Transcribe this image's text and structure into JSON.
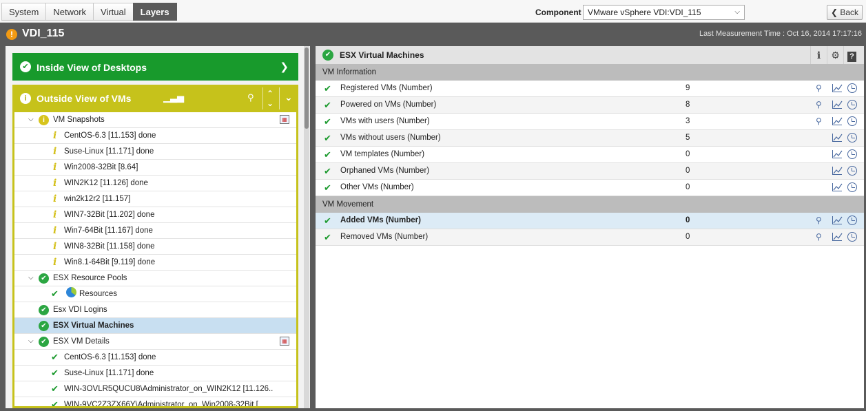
{
  "tabs": [
    "System",
    "Network",
    "Virtual",
    "Layers"
  ],
  "active_tab": "Layers",
  "component": {
    "label": "Component",
    "value": "VMware vSphere VDI:VDI_115"
  },
  "back_label": "Back",
  "title": "VDI_115",
  "last_measurement": "Last Measurement Time : Oct 16, 2014 17:17:16",
  "left": {
    "inside_view": "Inside View of Desktops",
    "outside_view": "Outside View of VMs",
    "tree": [
      {
        "label": "VM Snapshots",
        "level": 1,
        "icon": "yellow-info",
        "expanded": true,
        "tool": true
      },
      {
        "label": "CentOS-6.3 [11.153] done",
        "level": 2,
        "icon": "info-i"
      },
      {
        "label": "Suse-Linux [11.171] done",
        "level": 2,
        "icon": "info-i"
      },
      {
        "label": "Win2008-32Bit [8.64]",
        "level": 2,
        "icon": "info-i"
      },
      {
        "label": "WIN2K12 [11.126] done",
        "level": 2,
        "icon": "info-i"
      },
      {
        "label": "win2k12r2 [11.157]",
        "level": 2,
        "icon": "info-i"
      },
      {
        "label": "WIN7-32Bit [11.202] done",
        "level": 2,
        "icon": "info-i"
      },
      {
        "label": "Win7-64Bit [11.167] done",
        "level": 2,
        "icon": "info-i"
      },
      {
        "label": "WIN8-32Bit [11.158] done",
        "level": 2,
        "icon": "info-i"
      },
      {
        "label": "Win8.1-64Bit [9.119] done",
        "level": 2,
        "icon": "info-i"
      },
      {
        "label": "ESX Resource Pools",
        "level": 1,
        "icon": "green",
        "expanded": true
      },
      {
        "label": "Resources",
        "level": 2,
        "icon": "check-pie"
      },
      {
        "label": "Esx VDI Logins",
        "level": 1,
        "icon": "green"
      },
      {
        "label": "ESX Virtual Machines",
        "level": 1,
        "icon": "green",
        "selected": true
      },
      {
        "label": "ESX VM Details",
        "level": 1,
        "icon": "green",
        "expanded": true,
        "tool": true
      },
      {
        "label": "CentOS-6.3 [11.153] done",
        "level": 2,
        "icon": "check"
      },
      {
        "label": "Suse-Linux [11.171] done",
        "level": 2,
        "icon": "check"
      },
      {
        "label": "WIN-3OVLR5QUCU8\\Administrator_on_WIN2K12 [11.126..",
        "level": 2,
        "icon": "check"
      },
      {
        "label": "WIN-9VC2Z3ZX66Y\\Administrator_on_Win2008-32Bit [",
        "level": 2,
        "icon": "check"
      }
    ]
  },
  "right": {
    "header": "ESX Virtual Machines",
    "sections": [
      {
        "title": "VM Information",
        "rows": [
          {
            "name": "Registered VMs (Number)",
            "value": "9",
            "search": true
          },
          {
            "name": "Powered on VMs (Number)",
            "value": "8",
            "search": true
          },
          {
            "name": "VMs with users (Number)",
            "value": "3",
            "search": true
          },
          {
            "name": "VMs without users (Number)",
            "value": "5",
            "search": false
          },
          {
            "name": "VM templates (Number)",
            "value": "0",
            "search": false
          },
          {
            "name": "Orphaned VMs (Number)",
            "value": "0",
            "search": false
          },
          {
            "name": "Other VMs (Number)",
            "value": "0",
            "search": false
          }
        ]
      },
      {
        "title": "VM Movement",
        "rows": [
          {
            "name": "Added VMs (Number)",
            "value": "0",
            "search": true,
            "highlight": true
          },
          {
            "name": "Removed VMs (Number)",
            "value": "0",
            "search": true
          }
        ]
      }
    ]
  },
  "colors": {
    "green_banner": "#189a2c",
    "yellow_banner": "#c6c21b",
    "alert_orange": "#f29a12",
    "ok_green": "#2ba642"
  }
}
